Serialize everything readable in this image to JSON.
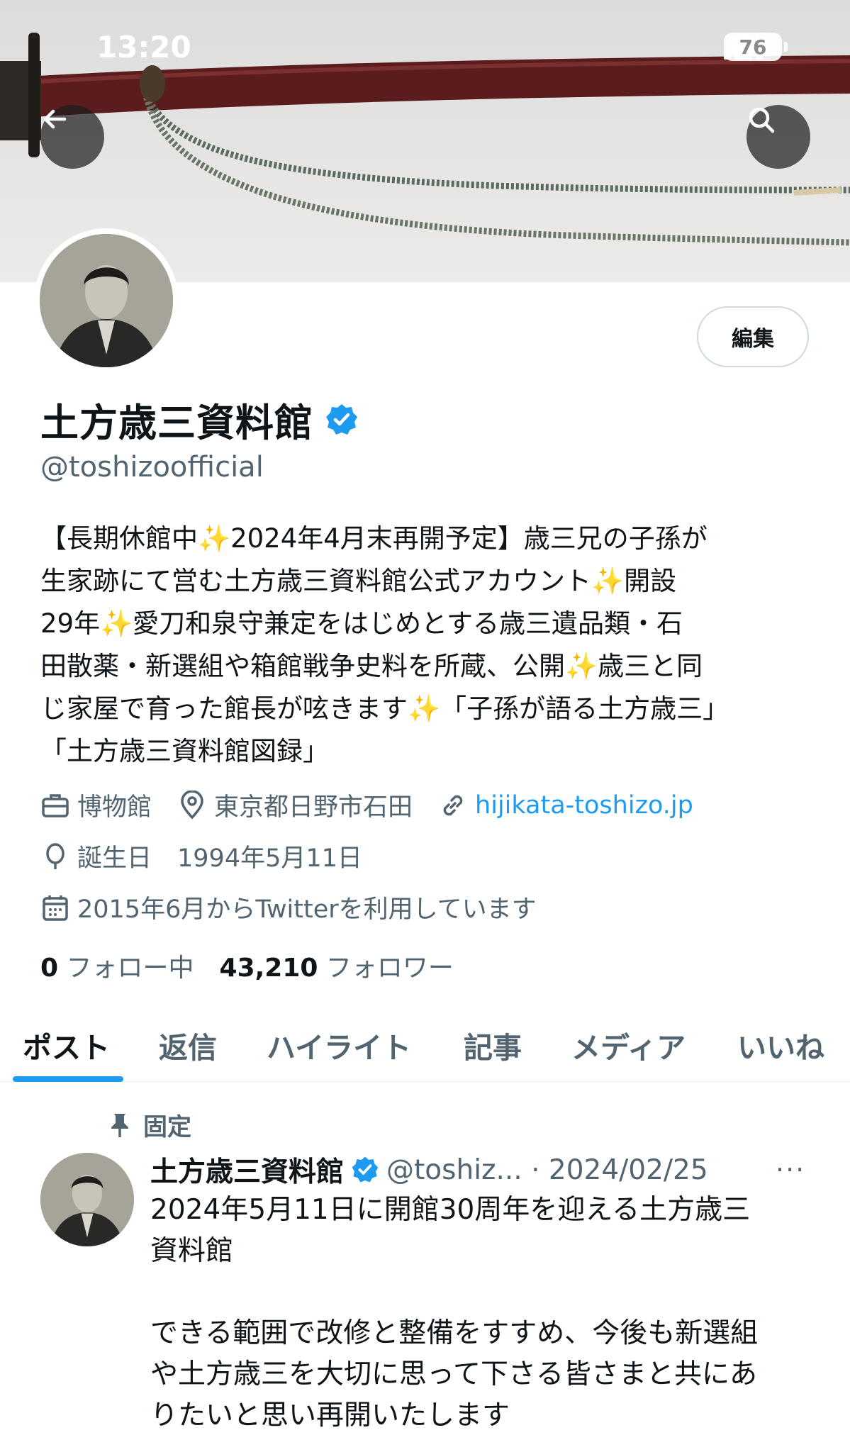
{
  "status_bar": {
    "time": "13:20",
    "battery": "76"
  },
  "profile": {
    "edit_label": "編集",
    "name": "土方歳三資料館",
    "handle": "@toshizoofficial",
    "bio_lines": [
      "【長期休館中✨2024年4月末再開予定】歳三兄の子孫が",
      "生家跡にて営む土方歳三資料館公式アカウント✨開設",
      "29年✨愛刀和泉守兼定をはじめとする歳三遺品類・石",
      "田散薬・新選組や箱館戦争史料を所蔵、公開✨歳三と同",
      "じ家屋で育った館長が呟きます✨「子孫が語る土方歳三」",
      "「土方歳三資料館図録」"
    ],
    "category": "博物館",
    "location": "東京都日野市石田",
    "website": "hijikata-toshizo.jp",
    "birthday_label": "誕生日",
    "birthday": "1994年5月11日",
    "joined": "2015年6月からTwitterを利用しています",
    "following_count": "0",
    "following_label": "フォロー中",
    "followers_count": "43,210",
    "followers_label": "フォロワー"
  },
  "tabs": [
    "ポスト",
    "返信",
    "ハイライト",
    "記事",
    "メディア",
    "いいね"
  ],
  "pinned_post": {
    "pinned_label": "固定",
    "author": "土方歳三資料館",
    "handle_date": "@toshiz... · 2024/02/25",
    "more": "···",
    "lines": [
      "2024年5月11日に開館30周年を迎える土方歳三",
      "資料館",
      "",
      "できる範囲で改修と整備をすすめ、今後も新選組",
      "や土方歳三を大切に思って下さる皆さまと共にあ",
      "りたいと思い再開いたします"
    ]
  },
  "colors": {
    "accent": "#1d9bf0",
    "text": "#0f1419",
    "secondary": "#536471"
  }
}
